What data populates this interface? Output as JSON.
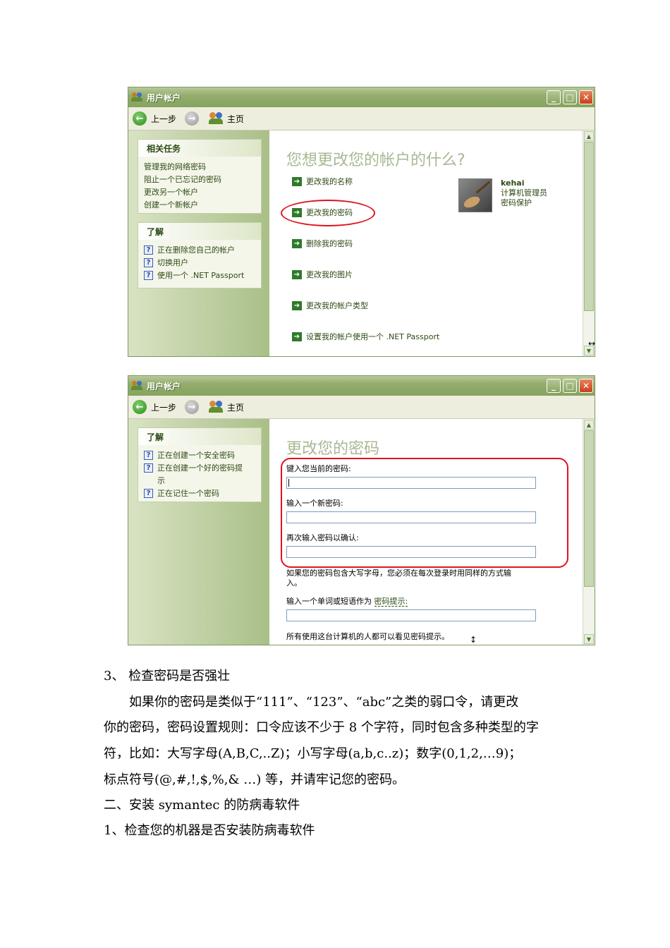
{
  "window1": {
    "title": "用户帐户",
    "toolbar": {
      "back": "上一步",
      "home": "主页"
    },
    "related_tasks": {
      "header": "相关任务",
      "items": [
        "管理我的网络密码",
        "阻止一个已忘记的密码",
        "更改另一个帐户",
        "创建一个新帐户"
      ]
    },
    "learn": {
      "header": "了解",
      "items": [
        "正在删除您自己的帐户",
        "切换用户",
        "使用一个 .NET Passport"
      ]
    },
    "heading": "您想更改您的帐户的什么?",
    "tasks": [
      "更改我的名称",
      "更改我的密码",
      "删除我的密码",
      "更改我的图片",
      "更改我的帐户类型",
      "设置我的帐户使用一个 .NET Passport"
    ],
    "user": {
      "name": "kehai",
      "role": "计算机管理员",
      "status": "密码保护"
    }
  },
  "window2": {
    "title": "用户帐户",
    "toolbar": {
      "back": "上一步",
      "home": "主页"
    },
    "learn": {
      "header": "了解",
      "items": [
        "正在创建一个安全密码",
        "正在创建一个好的密码提示",
        "正在记住一个密码"
      ]
    },
    "heading": "更改您的密码",
    "fields": {
      "current": "键入您当前的密码:",
      "new": "输入一个新密码:",
      "confirm": "再次输入密码以确认:"
    },
    "case_note_line1": "如果您的密码包含大写字母，您必须在每次登录时用同样的方式输",
    "case_note_line2": "入。",
    "hint_label": "输入一个单词或短语作为",
    "hint_link": "密码提示:",
    "hint_note": "所有使用这台计算机的人都可以看见密码提示。"
  },
  "document": {
    "section3": "3、    检查密码是否强壮",
    "para1_line1": "如果你的密码是类似于“111”、“123”、“abc”之类的弱口令，请更改",
    "para1_line2": "你的密码，密码设置规则：口令应该不少于 8 个字符，同时包含多种类型的字",
    "para1_line3": "符，比如：大写字母(A,B,C,..Z)；小写字母(a,b,c..z)；数字(0,1,2,…9)；",
    "para1_line4": "标点符号(@,#,!,$,%,& …) 等，并请牢记您的密码。",
    "heading2": "二、安装 symantec 的防病毒软件",
    "item1": "1、检查您的机器是否安装防病毒软件"
  }
}
